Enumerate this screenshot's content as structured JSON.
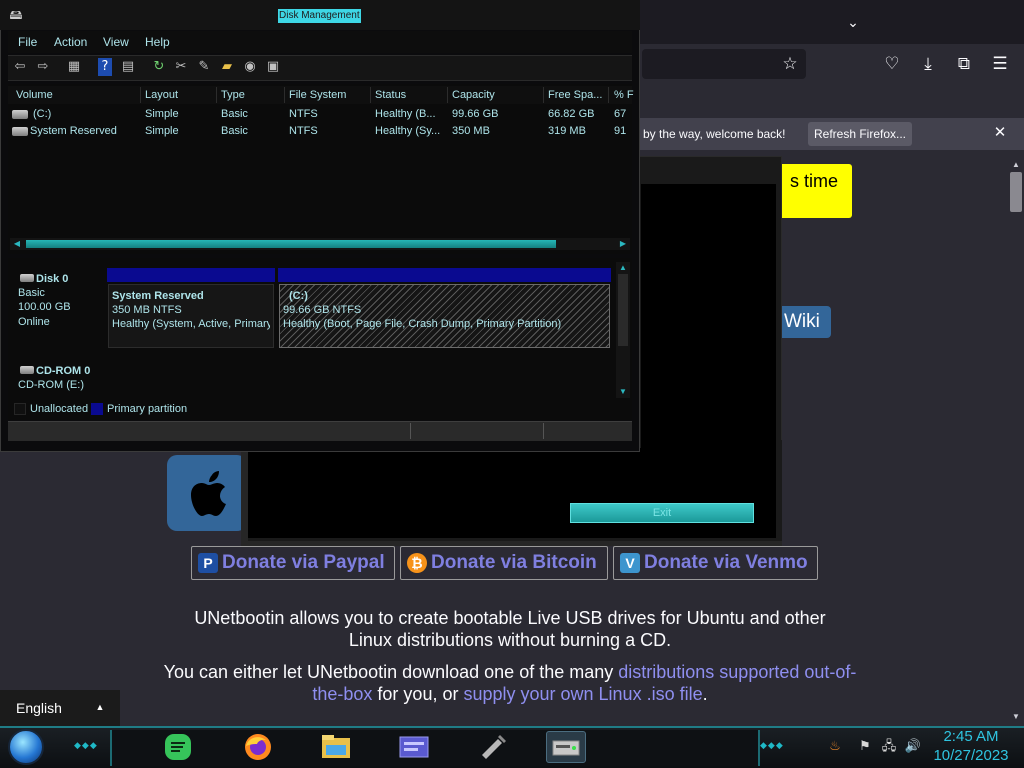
{
  "browser": {
    "notification_text": "by the way, welcome back!",
    "refresh_button": "Refresh Firefox...",
    "close_glyph": "✕",
    "icons": [
      "chevron-down-icon",
      "star-icon",
      "pocket-icon",
      "download-icon",
      "extensions-icon",
      "menu-icon"
    ]
  },
  "page": {
    "yellow_box_text": "s time",
    "wiki_button": "Wiki",
    "donate": [
      {
        "label": "Donate via Paypal",
        "icon": "paypal-icon",
        "color": "#1e4fa3"
      },
      {
        "label": "Donate via Bitcoin",
        "icon": "bitcoin-icon",
        "color": "#f7931a"
      },
      {
        "label": "Donate via Venmo",
        "icon": "venmo-icon",
        "color": "#3d95ce"
      }
    ],
    "desc1_line1": "UNetbootin allows you to create bootable Live USB drives for Ubuntu and other",
    "desc1_line2": "Linux distributions without burning a CD.",
    "desc2_a": "You can either let UNetbootin download one of the many ",
    "desc2_link1": "distributions supported out-of-the-box",
    "desc2_b": " for you, or ",
    "desc2_link2": "supply your own Linux .iso file",
    "desc2_c": ".",
    "language": "English"
  },
  "unetbootin": {
    "exit_button": "Exit"
  },
  "disk_management": {
    "title": "Disk Management",
    "menu": [
      "File",
      "Action",
      "View",
      "Help"
    ],
    "columns": [
      "Volume",
      "Layout",
      "Type",
      "File System",
      "Status",
      "Capacity",
      "Free Spa...",
      "% F"
    ],
    "rows": [
      [
        "(C:)",
        "Simple",
        "Basic",
        "NTFS",
        "Healthy (B...",
        "99.66 GB",
        "66.82 GB",
        "67"
      ],
      [
        "System Reserved",
        "Simple",
        "Basic",
        "NTFS",
        "Healthy (Sy...",
        "350 MB",
        "319 MB",
        "91"
      ]
    ],
    "disk0": {
      "name": "Disk 0",
      "type": "Basic",
      "size": "100.00 GB",
      "state": "Online",
      "partitions": [
        {
          "name": "System Reserved",
          "size": "350 MB NTFS",
          "status": "Healthy (System, Active, Primary"
        },
        {
          "name": "(C:)",
          "size": "99.66 GB NTFS",
          "status": "Healthy (Boot, Page File, Crash Dump, Primary Partition)"
        }
      ]
    },
    "cdrom": {
      "name": "CD-ROM 0",
      "drive": "CD-ROM (E:)"
    },
    "legend": [
      {
        "label": "Unallocated",
        "color": "#101010"
      },
      {
        "label": "Primary partition",
        "color": "#0a0a90"
      }
    ]
  },
  "taskbar": {
    "apps": [
      "notes-icon",
      "firefox-icon",
      "file-explorer-icon",
      "control-panel-icon",
      "usb-tool-icon",
      "disk-management-icon"
    ],
    "time": "2:45 AM",
    "date": "10/27/2023",
    "tray_icons": [
      "java-icon",
      "flag-icon",
      "network-icon",
      "volume-icon"
    ]
  }
}
